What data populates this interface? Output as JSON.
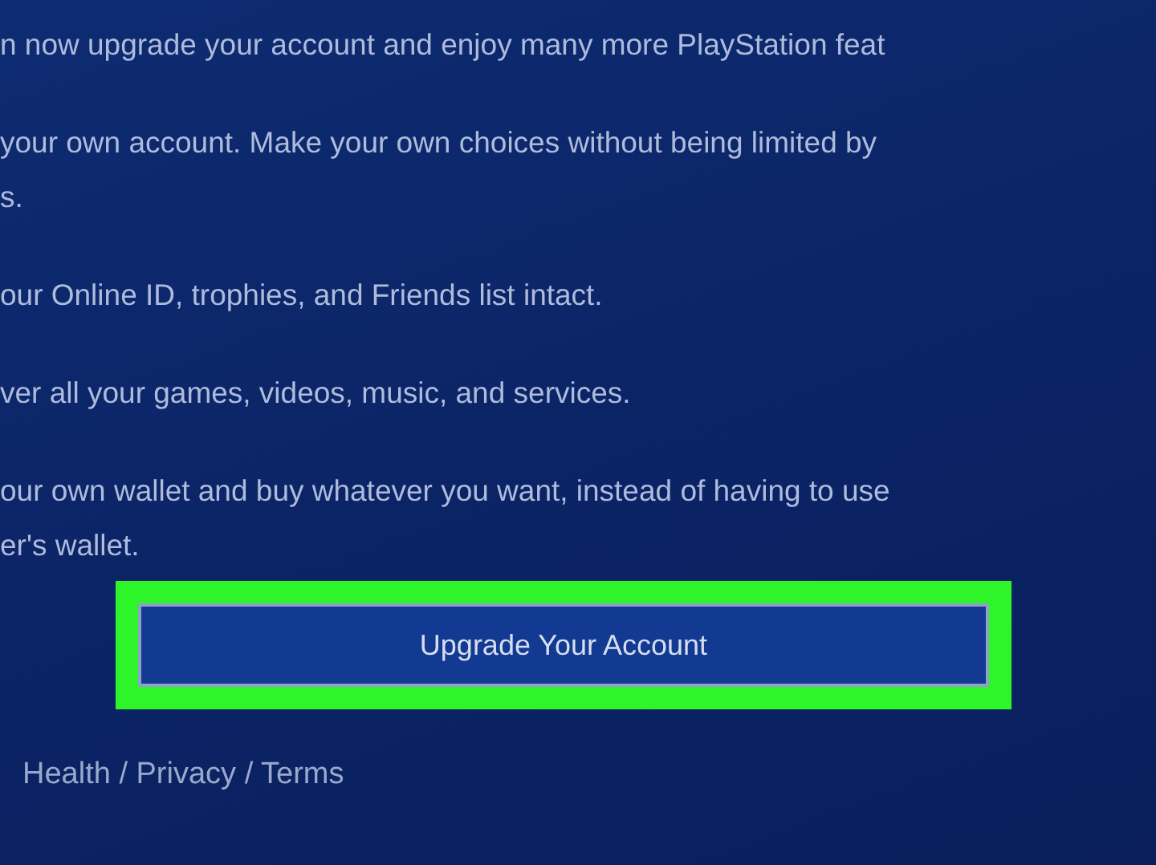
{
  "paragraphs": [
    {
      "lines": [
        "n now upgrade your account and enjoy many more PlayStation feat"
      ]
    },
    {
      "lines": [
        "your own account. Make your own choices without being limited by",
        "s."
      ]
    },
    {
      "lines": [
        "our Online ID, trophies, and Friends list intact."
      ]
    },
    {
      "lines": [
        "ver all your games, videos, music, and services."
      ]
    },
    {
      "lines": [
        "our own wallet and buy whatever you want, instead of having to use",
        "er's wallet."
      ]
    }
  ],
  "button": {
    "label": "Upgrade Your Account",
    "highlighted": true
  },
  "footer": {
    "links": [
      "Health / Privacy / Terms"
    ]
  }
}
